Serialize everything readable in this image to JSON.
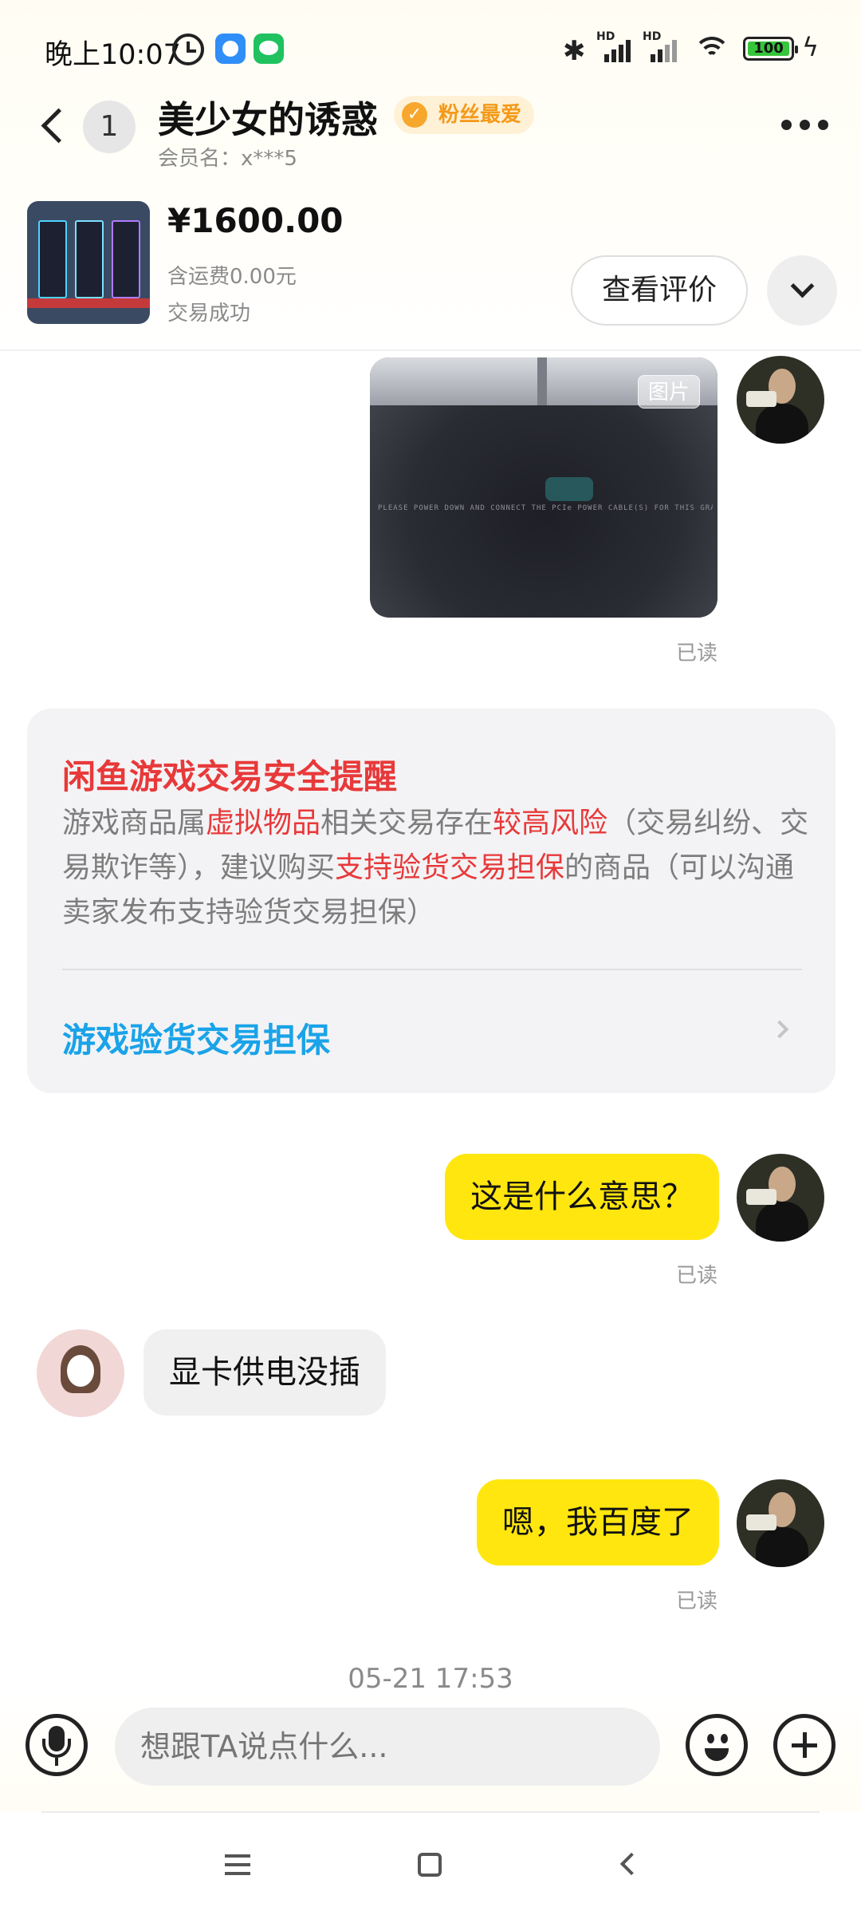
{
  "status_bar": {
    "time": "晚上10:07",
    "bluetooth_icon": "bluetooth-icon",
    "signal_hd_1": "HD",
    "signal_hd_2": "HD",
    "battery": "100"
  },
  "header": {
    "unread_count": "1",
    "nickname": "美少女的诱惑",
    "fan_badge": "粉丝最爱",
    "member_name": "会员名：x***5"
  },
  "product": {
    "price": "¥1600.00",
    "shipping": "含运费0.00元",
    "status": "交易成功",
    "review_button": "查看评价"
  },
  "messages": {
    "image_tag": "图片",
    "image_error_text": "PLEASE POWER DOWN AND CONNECT THE PCIe POWER CABLE(S) FOR THIS GRAPHICS CARD",
    "read_1": "已读",
    "read_2": "已读",
    "read_3": "已读",
    "msg_1": "这是什么意思？",
    "msg_2": "显卡供电没插",
    "msg_3": "嗯，我百度了",
    "timestamp": "05-21 17:53"
  },
  "safety": {
    "title": "闲鱼游戏交易安全提醒",
    "part1": "游戏商品属",
    "hl1": "虚拟物品",
    "part2": "相关交易存在",
    "hl2": "较高风险",
    "part3": "（交易纠纷、交易欺诈等），建议购买",
    "hl3": "支持验货交易担保",
    "part4": "的商品（可以沟通卖家发布支持验货交易担保）",
    "link": "游戏验货交易担保"
  },
  "input": {
    "placeholder": "想跟TA说点什么..."
  },
  "colors": {
    "accent_yellow": "#ffe60f",
    "warning_red": "#e8393a",
    "link_blue": "#1aa3e8",
    "fan_badge_orange": "#f39a1a"
  }
}
